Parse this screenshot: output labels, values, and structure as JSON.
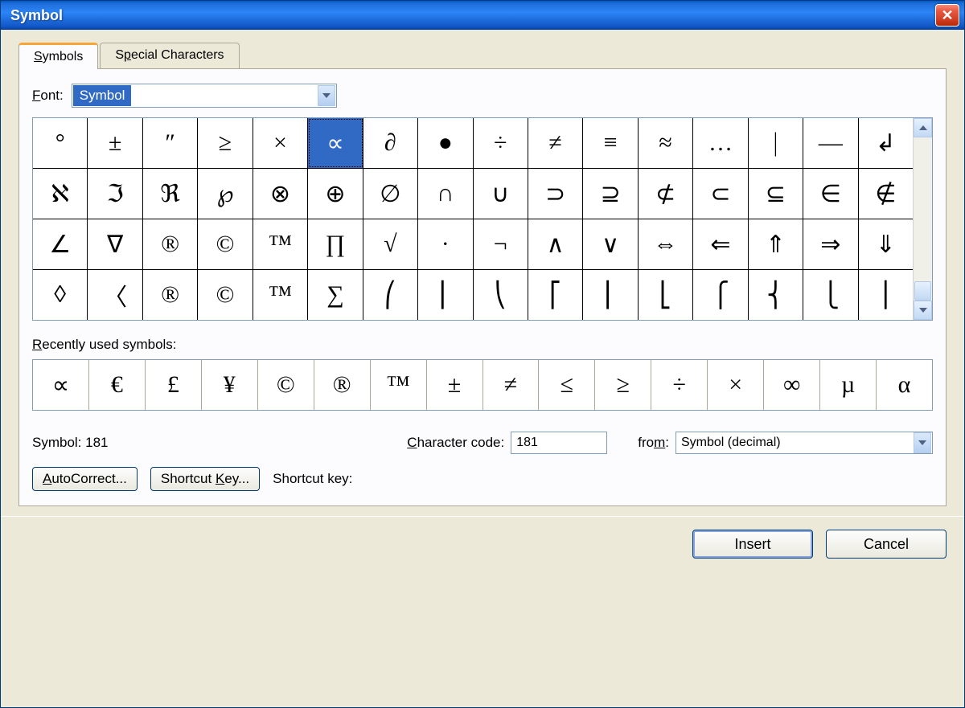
{
  "title": "Symbol",
  "tabs": {
    "symbols": "Symbols",
    "special": "Special Characters"
  },
  "font": {
    "label": "Font:",
    "value": "Symbol"
  },
  "grid": {
    "selected_row": 0,
    "selected_col": 5,
    "rows": [
      [
        "°",
        "±",
        "″",
        "≥",
        "×",
        "∝",
        "∂",
        "●",
        "÷",
        "≠",
        "≡",
        "≈",
        "…",
        "｜",
        "—",
        "↲"
      ],
      [
        "ℵ",
        "ℑ",
        "ℜ",
        "℘",
        "⊗",
        "⊕",
        "∅",
        "∩",
        "∪",
        "⊃",
        "⊇",
        "⊄",
        "⊂",
        "⊆",
        "∈",
        "∉"
      ],
      [
        "∠",
        "∇",
        "®",
        "©",
        "™",
        "∏",
        "√",
        "·",
        "¬",
        "∧",
        "∨",
        "⇔",
        "⇐",
        "⇑",
        "⇒",
        "⇓"
      ],
      [
        "◊",
        "〈",
        "®",
        "©",
        "™",
        "∑",
        "⎛",
        "⎜",
        "⎝",
        "⎡",
        "⎢",
        "⎣",
        "⎧",
        "⎨",
        "⎩",
        "⎪"
      ]
    ]
  },
  "recent_label": "Recently used symbols:",
  "recent": [
    "∝",
    "€",
    "£",
    "¥",
    "©",
    "®",
    "™",
    "±",
    "≠",
    "≤",
    "≥",
    "÷",
    "×",
    "∞",
    "µ",
    "α"
  ],
  "info": {
    "symbol_label": "Symbol: 181",
    "char_code_label": "Character code:",
    "char_code_value": "181",
    "from_label": "from:",
    "from_value": "Symbol (decimal)"
  },
  "buttons": {
    "autocorrect": "AutoCorrect...",
    "shortcut_key_btn": "Shortcut Key...",
    "shortcut_key_label": "Shortcut key:",
    "insert": "Insert",
    "cancel": "Cancel"
  }
}
